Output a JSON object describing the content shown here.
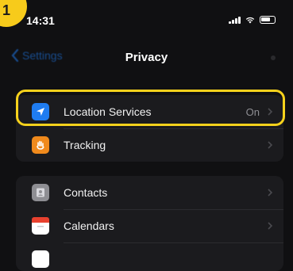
{
  "status": {
    "time": "14:31",
    "step": "1"
  },
  "nav": {
    "back_label": "Settings",
    "title": "Privacy"
  },
  "group1": [
    {
      "label": "Location Services",
      "value": "On",
      "icon": "location-arrow-icon",
      "color": "#1f7cf0"
    },
    {
      "label": "Tracking",
      "value": "",
      "icon": "tracking-icon",
      "color": "#f08a1c"
    }
  ],
  "group2": [
    {
      "label": "Contacts",
      "icon": "contacts-icon",
      "color": "#8e8e93"
    },
    {
      "label": "Calendars",
      "icon": "calendar-icon",
      "color": "#e8412f"
    }
  ],
  "colors": {
    "accent": "#1f7cf0",
    "highlight": "#f7d21c",
    "badge": "#f7cb1b"
  }
}
